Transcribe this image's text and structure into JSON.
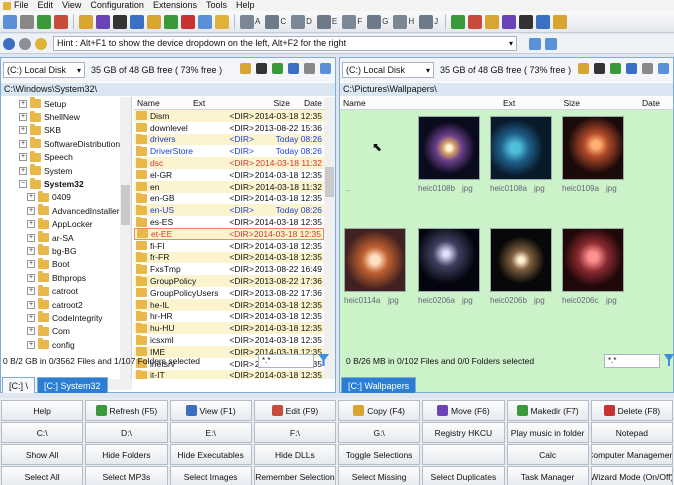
{
  "menu": [
    "File",
    "Edit",
    "View",
    "Configuration",
    "Extensions",
    "Tools",
    "Help"
  ],
  "toolbar": {
    "drive_letters": [
      "A",
      "C",
      "D",
      "E",
      "F",
      "G",
      "H",
      "J"
    ]
  },
  "hint": {
    "text": "Hint : Alt+F1 to show the device dropdown on the left, Alt+F2 for the right"
  },
  "left": {
    "drive": "(C:) Local Disk",
    "free": "35 GB of 48 GB free ( 73% free )",
    "path": "C:\\Windows\\System32\\",
    "columns": [
      "Name",
      "Ext",
      "Size",
      "Date"
    ],
    "tree": [
      "Setup",
      "ShellNew",
      "SKB",
      "SoftwareDistribution",
      "Speech",
      "System",
      "System32",
      "0409",
      "AdvancedInstallers",
      "AppLocker",
      "ar-SA",
      "bg-BG",
      "Boot",
      "Bthprops",
      "catroot",
      "catroot2",
      "CodeIntegrity",
      "Com",
      "config"
    ],
    "files": [
      {
        "name": "Dism",
        "size": "<DIR>",
        "date": "2014-03-18 12:35",
        "color": "#111111"
      },
      {
        "name": "downlevel",
        "size": "<DIR>",
        "date": "2013-08-22 15:36",
        "color": "#111111"
      },
      {
        "name": "drivers",
        "size": "<DIR>",
        "date": "Today 08:26",
        "color": "#1a3fd6"
      },
      {
        "name": "DriverStore",
        "size": "<DIR>",
        "date": "Today 08:26",
        "color": "#1a3fd6"
      },
      {
        "name": "dsc",
        "size": "<DIR>",
        "date": "2014-03-18 11:32",
        "color": "#d4362b"
      },
      {
        "name": "el-GR",
        "size": "<DIR>",
        "date": "2014-03-18 12:35",
        "color": "#111111"
      },
      {
        "name": "en",
        "size": "<DIR>",
        "date": "2014-03-18 11:32",
        "color": "#111111"
      },
      {
        "name": "en-GB",
        "size": "<DIR>",
        "date": "2014-03-18 12:35",
        "color": "#111111"
      },
      {
        "name": "en-US",
        "size": "<DIR>",
        "date": "Today 08:26",
        "color": "#1a3fd6"
      },
      {
        "name": "es-ES",
        "size": "<DIR>",
        "date": "2014-03-18 12:35",
        "color": "#111111"
      },
      {
        "name": "et-EE",
        "size": "<DIR>",
        "date": "2014-03-18 12:35",
        "color": "#d4362b"
      },
      {
        "name": "fi-FI",
        "size": "<DIR>",
        "date": "2014-03-18 12:35",
        "color": "#111111"
      },
      {
        "name": "fr-FR",
        "size": "<DIR>",
        "date": "2014-03-18 12:35",
        "color": "#111111"
      },
      {
        "name": "FxsTmp",
        "size": "<DIR>",
        "date": "2013-08-22 16:49",
        "color": "#111111"
      },
      {
        "name": "GroupPolicy",
        "size": "<DIR>",
        "date": "2013-08-22 17:36",
        "color": "#111111"
      },
      {
        "name": "GroupPolicyUsers",
        "size": "<DIR>",
        "date": "2013-08-22 17:36",
        "color": "#111111"
      },
      {
        "name": "he-IL",
        "size": "<DIR>",
        "date": "2014-03-18 12:35",
        "color": "#111111"
      },
      {
        "name": "hr-HR",
        "size": "<DIR>",
        "date": "2014-03-18 12:35",
        "color": "#111111"
      },
      {
        "name": "hu-HU",
        "size": "<DIR>",
        "date": "2014-03-18 12:35",
        "color": "#111111"
      },
      {
        "name": "icsxml",
        "size": "<DIR>",
        "date": "2014-03-18 12:35",
        "color": "#111111"
      },
      {
        "name": "IME",
        "size": "<DIR>",
        "date": "2014-03-18 12:35",
        "color": "#111111"
      },
      {
        "name": "inetsrv",
        "size": "<DIR>",
        "date": "2014-03-18 12:35",
        "color": "#111111"
      },
      {
        "name": "it-IT",
        "size": "<DIR>",
        "date": "2014-03-18 12:35",
        "color": "#111111"
      }
    ],
    "status": "0 B/2 GB in 0/3562 Files and 1/107 Folders selected",
    "filter": "*.*",
    "tabs": [
      "[C:] \\",
      "[C:] System32"
    ]
  },
  "right": {
    "drive": "(C:) Local Disk",
    "free": "35 GB of 48 GB free ( 73% free )",
    "path": "C:\\Pictures\\Wallpapers\\",
    "columns": [
      "Name",
      "Ext",
      "Size",
      "Date"
    ],
    "thumbs": [
      {
        "name": "..",
        "ext": ""
      },
      {
        "name": "heic0108b",
        "ext": "jpg"
      },
      {
        "name": "heic0108a",
        "ext": "jpg"
      },
      {
        "name": "heic0109a",
        "ext": "jpg"
      },
      {
        "name": "heic0114a",
        "ext": "jpg"
      },
      {
        "name": "heic0206a",
        "ext": "jpg"
      },
      {
        "name": "heic0206b",
        "ext": "jpg"
      },
      {
        "name": "heic0206c",
        "ext": "jpg"
      }
    ],
    "status": "0 B/26 MB in 0/102 Files and 0/0 Folders selected",
    "filter": "*.*",
    "tabs": [
      "[C:] Wallpapers"
    ]
  },
  "buttons": [
    "Help",
    "Refresh (F5)",
    "View (F1)",
    "Edit (F9)",
    "Copy (F4)",
    "Move (F6)",
    "Makedir (F7)",
    "Delete (F8)",
    "C:\\",
    "D:\\",
    "E:\\",
    "F:\\",
    "G:\\",
    "Registry HKCU",
    "Play music in folder",
    "Notepad",
    "Show All",
    "Hide Folders",
    "Hide Executables",
    "Hide DLLs",
    "Toggle Selections",
    "",
    "Calc",
    "Computer Management",
    "Select All",
    "Select MP3s",
    "Select Images",
    "Remember Selection",
    "Select Missing",
    "Select Duplicates",
    "Task Manager",
    "Wizard Mode (On/Off)"
  ],
  "button_icons": {
    "1": "#3a9a3a",
    "2": "#3a6fc4",
    "3": "#c94b3b",
    "4": "#d8a531",
    "5": "#6a43b8",
    "6": "#3a9a3a",
    "7": "#c93232"
  }
}
